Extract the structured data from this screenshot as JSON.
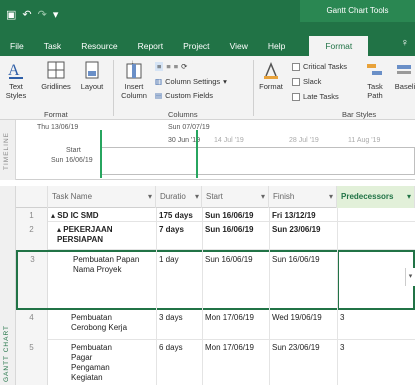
{
  "app": {
    "tool_context": "Gantt Chart Tools",
    "help_icon": "lightbulb-icon"
  },
  "tabs": [
    "File",
    "Task",
    "Resource",
    "Report",
    "Project",
    "View",
    "Help",
    "Format"
  ],
  "ribbon": {
    "text_styles": "Text\nStyles",
    "gridlines": "Gridlines",
    "layout": "Layout",
    "insert_column": "Insert\nColumn",
    "column_settings": "Column Settings",
    "custom_fields": "Custom Fields",
    "format": "Format",
    "critical_tasks": "Critical Tasks",
    "slack": "Slack",
    "late_tasks": "Late Tasks",
    "task_path": "Task\nPath",
    "baseline": "Baseli",
    "groups": {
      "format": "Format",
      "columns": "Columns",
      "bar_styles": "Bar Styles"
    }
  },
  "timeline": {
    "label": "TIMELINE",
    "start_date_top": "Thu 13/06/19",
    "today_label": "Sun 07/07/19",
    "ticks": [
      "30 Jun '19",
      "14 Jul '19",
      "28 Jul '19",
      "11 Aug '19"
    ],
    "start_word": "Start",
    "start_date": "Sun 16/06/19"
  },
  "grid": {
    "side_label": "GANTT CHART",
    "headers": {
      "task_name": "Task Name",
      "duration": "Duratio",
      "start": "Start",
      "finish": "Finish",
      "predecessors": "Predecessors"
    },
    "rows": [
      {
        "num": "1",
        "name": "▴ SD IC SMD",
        "duration": "175 days",
        "start": "Sun 16/06/19",
        "finish": "Fri 13/12/19",
        "pred": ""
      },
      {
        "num": "2",
        "name": "▴ PEKERJAAN PERSIAPAN",
        "duration": "7 days",
        "start": "Sun 16/06/19",
        "finish": "Sun 23/06/19",
        "pred": ""
      },
      {
        "num": "3",
        "name": "Pembuatan Papan Nama Proyek",
        "duration": "1 day",
        "start": "Sun 16/06/19",
        "finish": "Sun 16/06/19",
        "pred": ""
      },
      {
        "num": "4",
        "name": "Pembuatan Cerobong Kerja",
        "duration": "3 days",
        "start": "Mon 17/06/19",
        "finish": "Wed 19/06/19",
        "pred": "3"
      },
      {
        "num": "5",
        "name": "Pembuatan Pagar Pengaman Kegiatan",
        "duration": "6 days",
        "start": "Mon 17/06/19",
        "finish": "Sun 23/06/19",
        "pred": "3"
      }
    ]
  }
}
